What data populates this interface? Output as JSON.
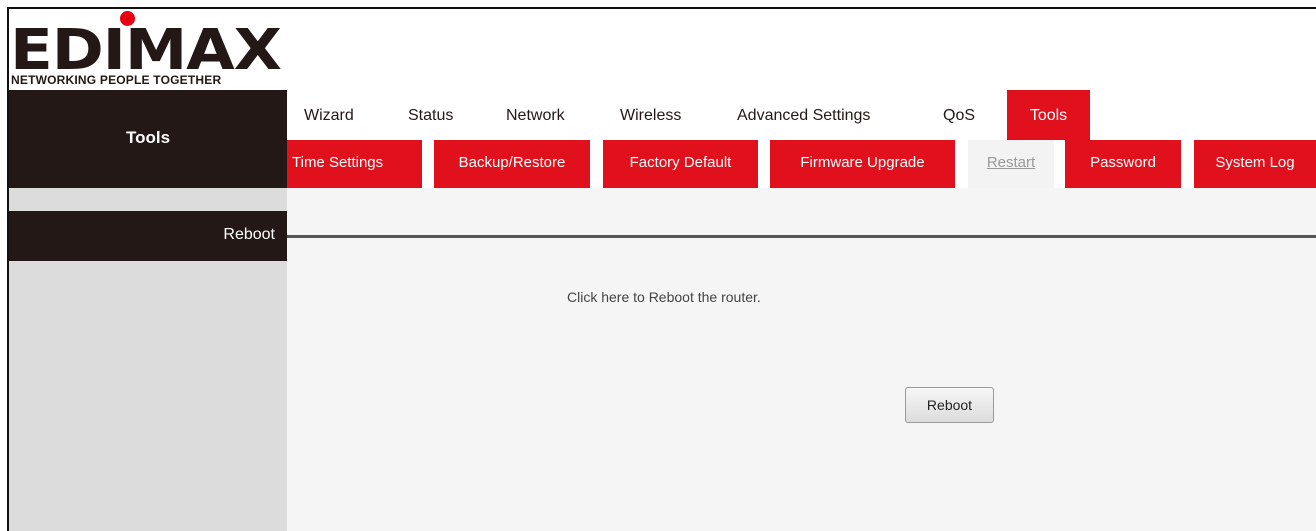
{
  "brand": {
    "logo_text": "EDIMAX",
    "tagline": "NETWORKING PEOPLE TOGETHER",
    "accent_color": "#e0101c",
    "dark_color": "#231815"
  },
  "sidebar": {
    "title": "Tools",
    "section": "Reboot"
  },
  "main_nav": {
    "active": "Tools",
    "items": [
      "Wizard",
      "Status",
      "Network",
      "Wireless",
      "Advanced Settings",
      "QoS",
      "Tools"
    ]
  },
  "sub_nav": {
    "active": "Restart",
    "items": [
      "Time Settings",
      "Backup/Restore",
      "Factory Default",
      "Firmware Upgrade",
      "Restart",
      "Password",
      "System Log"
    ]
  },
  "content": {
    "description": "Click here to Reboot the router.",
    "reboot_button": "Reboot"
  }
}
